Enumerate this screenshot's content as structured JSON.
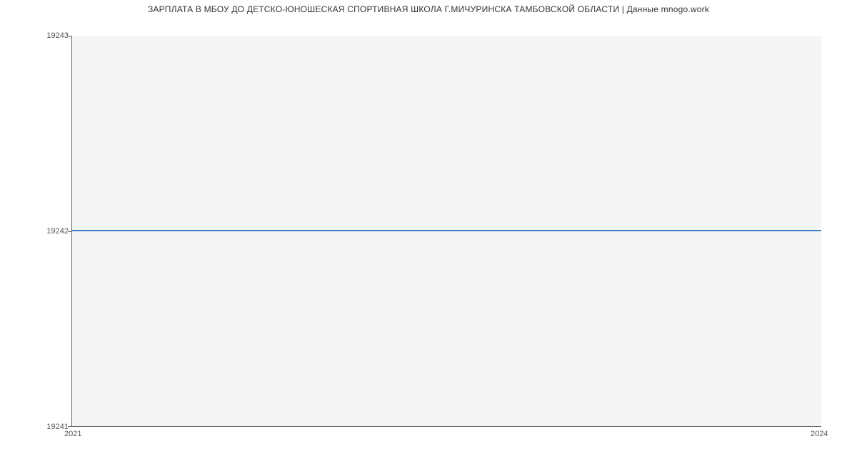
{
  "chart_data": {
    "type": "line",
    "title": "ЗАРПЛАТА В МБОУ ДО ДЕТСКО-ЮНОШЕСКАЯ СПОРТИВНАЯ ШКОЛА Г.МИЧУРИНСКА ТАМБОВСКОЙ ОБЛАСТИ | Данные mnogo.work",
    "x": [
      2021,
      2024
    ],
    "values": [
      19242,
      19242
    ],
    "ylim": [
      19241,
      19243
    ],
    "xlim": [
      2021,
      2024
    ],
    "y_ticks": [
      19241,
      19242,
      19243
    ],
    "x_ticks": [
      2021,
      2024
    ],
    "xlabel": "",
    "ylabel": ""
  },
  "labels": {
    "y_top": "19243",
    "y_mid": "19242",
    "y_bot": "19241",
    "x_left": "2021",
    "x_right": "2024"
  }
}
